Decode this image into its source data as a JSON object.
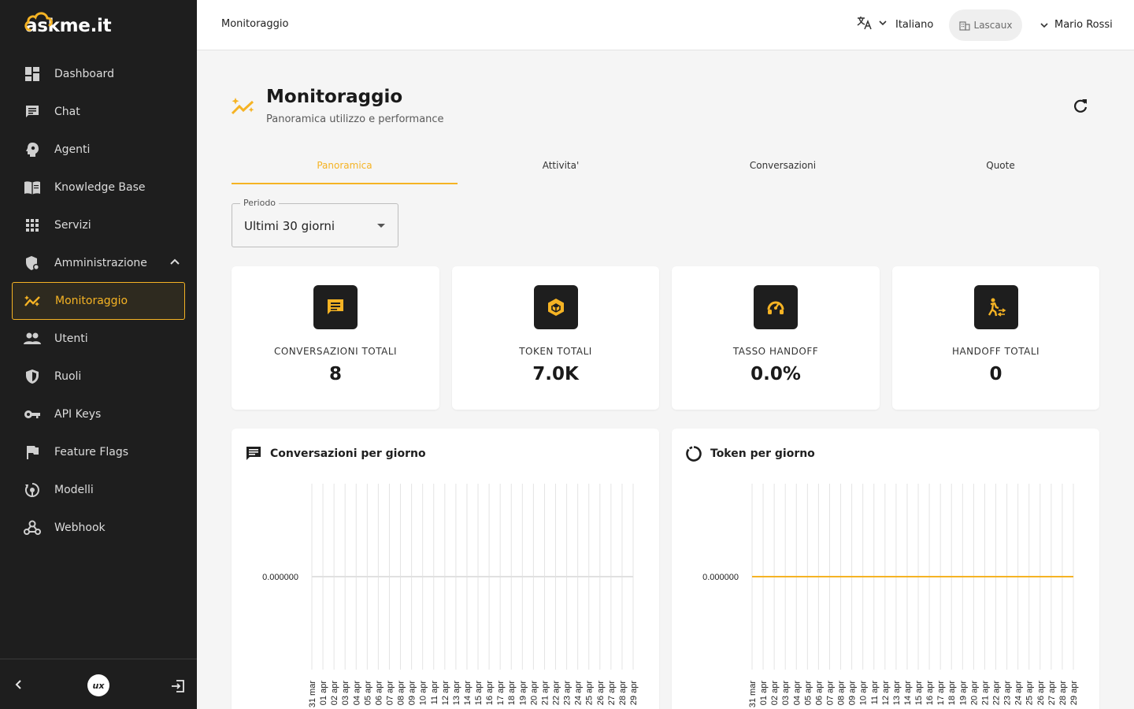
{
  "app": {
    "logo_text": "askme.it"
  },
  "sidebar": {
    "items": [
      {
        "label": "Dashboard",
        "icon": "dashboard-icon"
      },
      {
        "label": "Chat",
        "icon": "chat-icon"
      },
      {
        "label": "Agenti",
        "icon": "agent-icon"
      },
      {
        "label": "Knowledge Base",
        "icon": "book-icon"
      },
      {
        "label": "Servizi",
        "icon": "grid-icon"
      },
      {
        "label": "Amministrazione",
        "icon": "admin-shield-icon"
      },
      {
        "label": "Monitoraggio",
        "icon": "monitoring-icon"
      },
      {
        "label": "Utenti",
        "icon": "users-icon"
      },
      {
        "label": "Ruoli",
        "icon": "shield-icon"
      },
      {
        "label": "API Keys",
        "icon": "key-icon"
      },
      {
        "label": "Feature Flags",
        "icon": "flag-icon"
      },
      {
        "label": "Modelli",
        "icon": "model-icon"
      },
      {
        "label": "Webhook",
        "icon": "webhook-icon"
      }
    ],
    "footer_logo": "ux"
  },
  "header": {
    "breadcrumb": "Monitoraggio",
    "language": "Italiano",
    "tenant": "Lascaux",
    "user": "Mario Rossi"
  },
  "page": {
    "title": "Monitoraggio",
    "subtitle": "Panoramica utilizzo e performance"
  },
  "tabs": [
    "Panoramica",
    "Attivita'",
    "Conversazioni",
    "Quote"
  ],
  "period": {
    "label": "Periodo",
    "value": "Ultimi 30 giorni"
  },
  "kpis": [
    {
      "label": "CONVERSAZIONI TOTALI",
      "value": "8",
      "icon": "chat-icon"
    },
    {
      "label": "TOKEN TOTALI",
      "value": "7.0K",
      "icon": "token-icon"
    },
    {
      "label": "TASSO HANDOFF",
      "value": "0.0%",
      "icon": "handoff-rate-icon"
    },
    {
      "label": "HANDOFF TOTALI",
      "value": "0",
      "icon": "handoff-icon"
    }
  ],
  "colors": {
    "accent": "#f5b324",
    "sidebar_bg": "#1e1e1e"
  },
  "chart_data": [
    {
      "type": "line",
      "title": "Conversazioni per giorno",
      "x": [
        "31 mar",
        "01 apr",
        "02 apr",
        "03 apr",
        "04 apr",
        "05 apr",
        "06 apr",
        "07 apr",
        "08 apr",
        "09 apr",
        "10 apr",
        "11 apr",
        "12 apr",
        "13 apr",
        "14 apr",
        "15 apr",
        "16 apr",
        "17 apr",
        "18 apr",
        "19 apr",
        "20 apr",
        "21 apr",
        "22 apr",
        "23 apr",
        "24 apr",
        "25 apr",
        "26 apr",
        "27 apr",
        "28 apr",
        "29 apr"
      ],
      "series": [
        {
          "values": [
            0,
            0,
            0,
            0,
            0,
            0,
            0,
            0,
            0,
            0,
            0,
            0,
            0,
            0,
            0,
            0,
            0,
            0,
            0,
            0,
            0,
            0,
            0,
            0,
            0,
            0,
            0,
            0,
            0,
            0
          ],
          "color": "#e0e0e0"
        }
      ],
      "y_ticks": [
        "0.000000"
      ],
      "grid": true
    },
    {
      "type": "line",
      "title": "Token per giorno",
      "x": [
        "31 mar",
        "01 apr",
        "02 apr",
        "03 apr",
        "04 apr",
        "05 apr",
        "06 apr",
        "07 apr",
        "08 apr",
        "09 apr",
        "10 apr",
        "11 apr",
        "12 apr",
        "13 apr",
        "14 apr",
        "15 apr",
        "16 apr",
        "17 apr",
        "18 apr",
        "19 apr",
        "20 apr",
        "21 apr",
        "22 apr",
        "23 apr",
        "24 apr",
        "25 apr",
        "26 apr",
        "27 apr",
        "28 apr",
        "29 apr"
      ],
      "series": [
        {
          "values": [
            0,
            0,
            0,
            0,
            0,
            0,
            0,
            0,
            0,
            0,
            0,
            0,
            0,
            0,
            0,
            0,
            0,
            0,
            0,
            0,
            0,
            0,
            0,
            0,
            0,
            0,
            0,
            0,
            0,
            0
          ],
          "color": "#f5b324"
        }
      ],
      "y_ticks": [
        "0.000000"
      ],
      "grid": true
    }
  ]
}
